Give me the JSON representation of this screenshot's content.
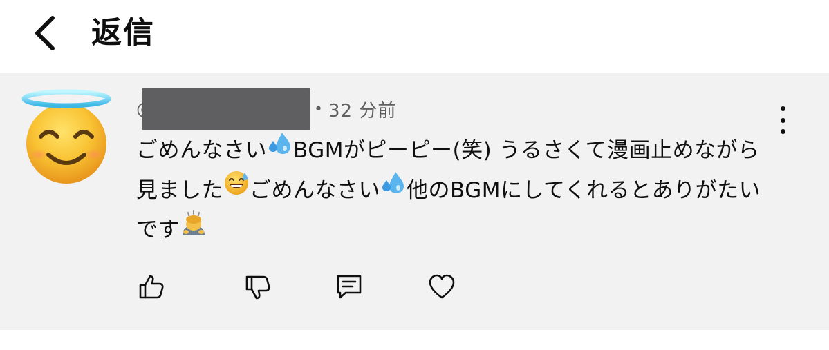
{
  "header": {
    "title": "返信",
    "back_icon": "chevron-left-icon"
  },
  "comment": {
    "author_handle": "@",
    "separator": "•",
    "timestamp": "32 分前",
    "text": {
      "p1": "ごめんなさい",
      "p2": "BGMがピーピー(笑) うるさくて漫画止めながら見ました",
      "p3": "ごめんなさい",
      "p4": "他のBGMにしてくれるとありがたいです"
    },
    "avatar_icon": "smiling-face-with-halo-emoji",
    "more_icon": "vertical-ellipsis-icon"
  },
  "actions": {
    "like_icon": "thumbs-up-icon",
    "dislike_icon": "thumbs-down-icon",
    "reply_icon": "comment-icon",
    "heart_icon": "heart-icon"
  },
  "colors": {
    "panel_bg": "#f2f2f2",
    "text_primary": "#0f0f0f",
    "text_secondary": "#606060",
    "redaction": "#5f5f61"
  }
}
